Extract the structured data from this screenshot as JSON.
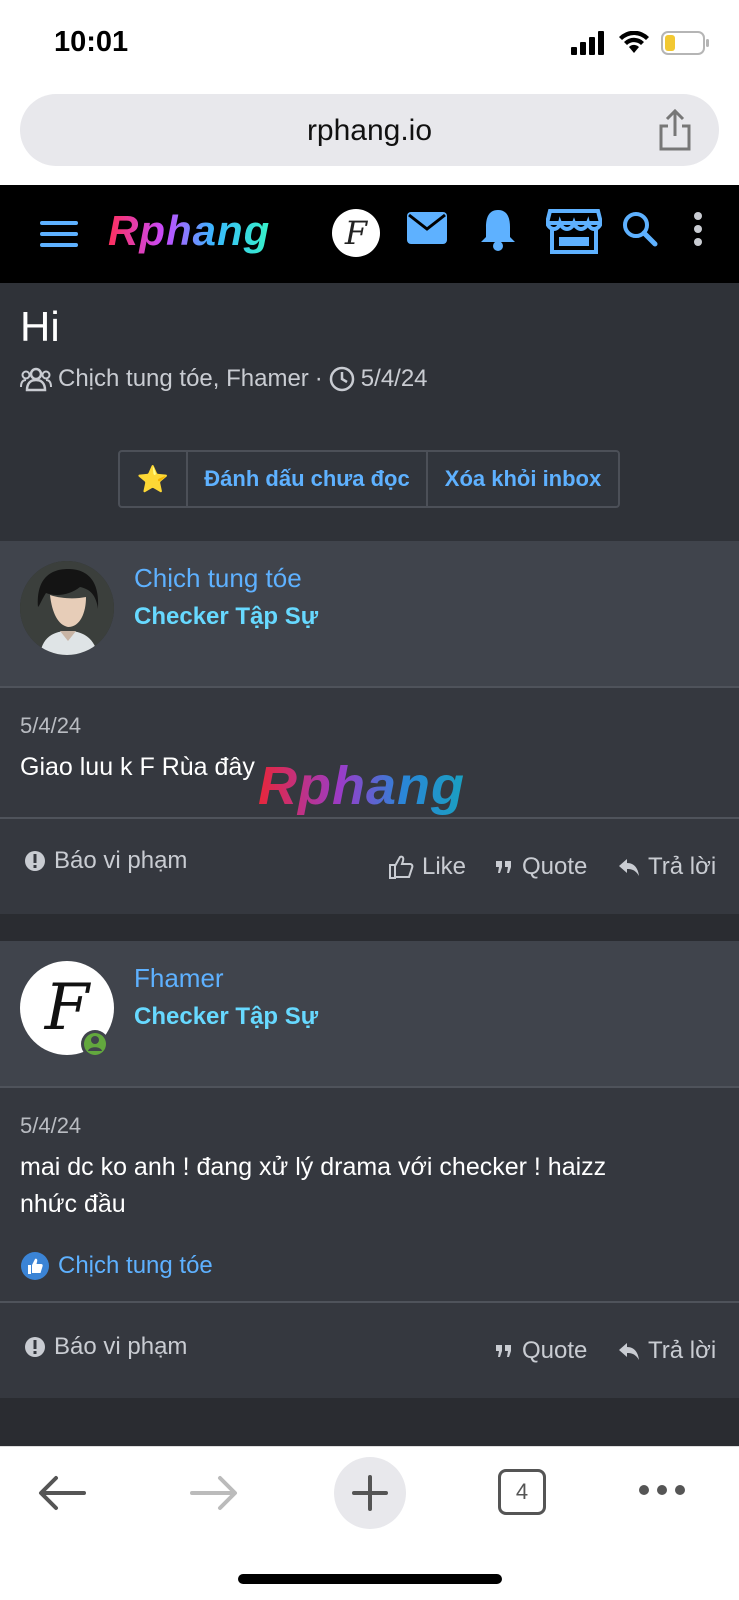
{
  "status_bar": {
    "time": "10:01"
  },
  "browser": {
    "url": "rphang.io",
    "tab_count": "4"
  },
  "site": {
    "logo_text": "Rphang",
    "header_avatar_letter": "F"
  },
  "conversation": {
    "title": "Hi",
    "participants": "Chịch tung tóe, Fhamer",
    "separator": "·",
    "date": "5/4/24",
    "actions": {
      "star": "⭐",
      "mark_unread": "Đánh dấu chưa đọc",
      "remove_inbox": "Xóa khỏi inbox"
    }
  },
  "messages": [
    {
      "username": "Chịch tung tóe",
      "user_title": "Checker Tập Sự",
      "date": "5/4/24",
      "text": "Giao luu k F Rùa đây",
      "report": "Báo vi phạm",
      "like": "Like",
      "quote": "Quote",
      "reply": "Trả lời"
    },
    {
      "username": "Fhamer",
      "user_title": "Checker Tập Sự",
      "avatar_letter": "F",
      "date": "5/4/24",
      "text": "mai dc ko anh ! đang xử lý drama với checker ! haizz nhức đầu",
      "liked_by": "Chịch tung tóe",
      "report": "Báo vi phạm",
      "quote": "Quote",
      "reply": "Trả lời"
    }
  ],
  "watermark": "Rphang",
  "colors": {
    "accent": "#5eb1ff",
    "user_title": "#67d9ff",
    "bg": "#2f3238"
  }
}
